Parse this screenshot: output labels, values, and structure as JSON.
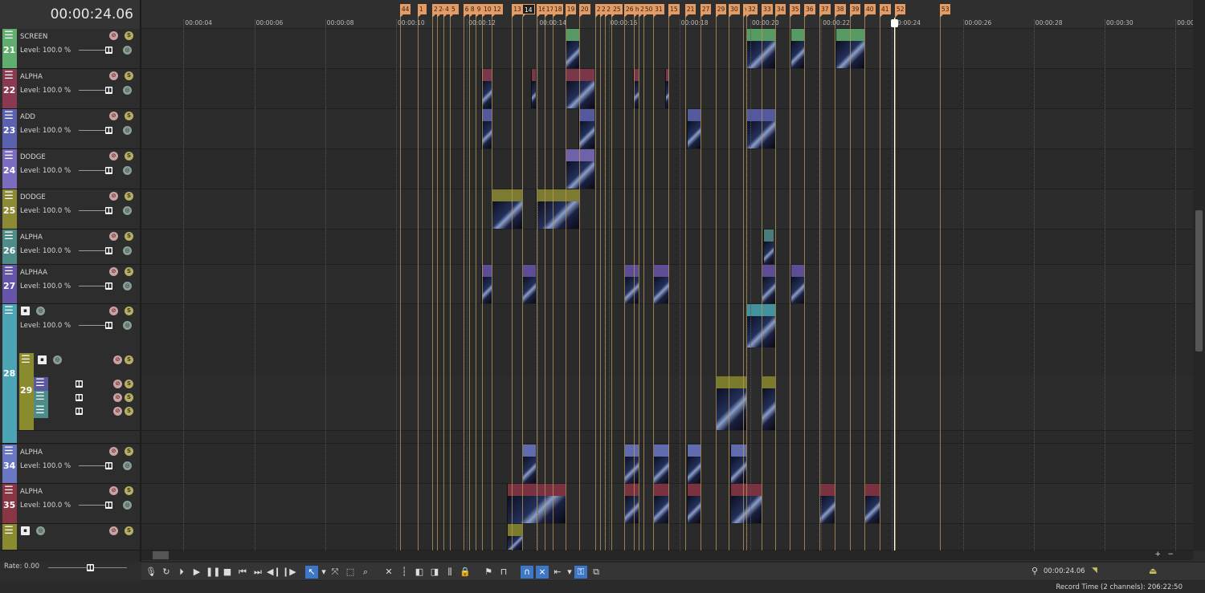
{
  "timecode": "00:00:24.06",
  "ruler_labels": [
    {
      "t": 4,
      "label": "00:00:04"
    },
    {
      "t": 6,
      "label": "00:00:06"
    },
    {
      "t": 8,
      "label": "00:00:08"
    },
    {
      "t": 10,
      "label": "00:00:10"
    },
    {
      "t": 12,
      "label": "00:00:12"
    },
    {
      "t": 14,
      "label": "00:00:14"
    },
    {
      "t": 16,
      "label": "00:00:16"
    },
    {
      "t": 18,
      "label": "00:00:18"
    },
    {
      "t": 20,
      "label": "00:00:20"
    },
    {
      "t": 22,
      "label": "00:00:22"
    },
    {
      "t": 24,
      "label": "00:00:24"
    },
    {
      "t": 26,
      "label": "00:00:26"
    },
    {
      "t": 28,
      "label": "00:00:28"
    },
    {
      "t": 30,
      "label": "00:00:30"
    },
    {
      "t": 32,
      "label": "00:00:32"
    }
  ],
  "playhead_time": 24.06,
  "markers": [
    [
      "44",
      10.11
    ],
    [
      "1",
      10.61
    ],
    [
      "2",
      11.02
    ],
    [
      "24",
      11.16
    ],
    [
      "4",
      11.34
    ],
    [
      "5",
      11.52
    ],
    [
      "6",
      11.9
    ],
    [
      "8",
      12.06
    ],
    [
      "9",
      12.24
    ],
    [
      "10",
      12.43
    ],
    [
      "12",
      12.7
    ],
    [
      "13",
      13.27
    ],
    [
      "14",
      13.56
    ],
    [
      "16",
      13.97
    ],
    [
      "17",
      14.19
    ],
    [
      "18",
      14.42
    ],
    [
      "19",
      14.78
    ],
    [
      "20",
      15.17
    ],
    [
      "2",
      15.62
    ],
    [
      "2",
      15.76
    ],
    [
      "2",
      15.9
    ],
    [
      "25",
      16.08
    ],
    [
      "26",
      16.44
    ],
    [
      "ha",
      16.71
    ],
    [
      "2",
      16.85
    ],
    [
      "50",
      16.98
    ],
    [
      "31",
      17.26
    ],
    [
      "15",
      17.69
    ],
    [
      "21",
      18.16
    ],
    [
      "27",
      18.59
    ],
    [
      "29",
      19.02
    ],
    [
      "30",
      19.39
    ],
    [
      "ve",
      19.8
    ],
    [
      "32",
      19.89
    ],
    [
      "33",
      20.32
    ],
    [
      "34",
      20.7
    ],
    [
      "35",
      21.11
    ],
    [
      "36",
      21.52
    ],
    [
      "37",
      21.95
    ],
    [
      "38",
      22.38
    ],
    [
      "39",
      22.81
    ],
    [
      "40",
      23.22
    ],
    [
      "41",
      23.65
    ],
    [
      "52",
      24.08
    ],
    [
      "53",
      25.35
    ]
  ],
  "selected_marker": "14",
  "tracks": [
    {
      "num": "21",
      "name": "SCREEN",
      "level": "Level: 100.0 %",
      "color": "#5fae6e",
      "clips": [
        [
          14.78,
          15.17
        ],
        [
          19.89,
          20.7
        ],
        [
          21.13,
          21.52
        ],
        [
          22.4,
          23.22
        ]
      ]
    },
    {
      "num": "22",
      "name": "ALPHA",
      "level": "Level: 100.0 %",
      "color": "#8a3a50",
      "clips": [
        [
          12.4,
          12.7
        ],
        [
          13.82,
          13.95
        ],
        [
          14.78,
          15.6
        ],
        [
          16.7,
          16.85
        ],
        [
          17.6,
          17.71
        ]
      ]
    },
    {
      "num": "23",
      "name": "ADD",
      "level": "Level: 100.0 %",
      "color": "#5a62b0",
      "clips": [
        [
          12.4,
          12.7
        ],
        [
          15.15,
          15.6
        ],
        [
          18.2,
          18.6
        ],
        [
          19.89,
          20.7
        ]
      ]
    },
    {
      "num": "24",
      "name": "DODGE",
      "level": "Level: 100.0 %",
      "color": "#7c6cc0",
      "clips": [
        [
          14.78,
          15.6
        ]
      ]
    },
    {
      "num": "25",
      "name": "DODGE",
      "level": "Level: 100.0 %",
      "color": "#8c8a34",
      "clips": [
        [
          12.7,
          13.56
        ],
        [
          13.95,
          15.17
        ]
      ]
    },
    {
      "num": "26",
      "name": "ALPHA",
      "level": "Level: 100.0 %",
      "color": "#4e8c8a",
      "clips": [
        [
          20.36,
          20.66
        ]
      ]
    },
    {
      "num": "27",
      "name": "ALPHAA",
      "level": "Level: 100.0 %",
      "color": "#6654a8",
      "clips": [
        [
          12.4,
          12.7
        ],
        [
          13.56,
          13.95
        ],
        [
          16.44,
          16.85
        ],
        [
          17.26,
          17.71
        ],
        [
          20.32,
          20.7
        ],
        [
          21.13,
          21.52
        ]
      ]
    },
    {
      "num": "28",
      "name": "",
      "level": "Level: 100.0 %",
      "color": "#4aa4b4",
      "clips": [
        [
          19.89,
          20.7
        ]
      ]
    },
    {
      "num": "29",
      "name": "",
      "level": "",
      "color": "#8a8a2e",
      "clips": [
        [
          19.02,
          19.89
        ],
        [
          20.32,
          20.7
        ]
      ]
    },
    {
      "num": "34",
      "name": "ALPHA",
      "level": "Level: 100.0 %",
      "color": "#6a78c4",
      "clips": [
        [
          13.56,
          13.95
        ],
        [
          16.44,
          16.85
        ],
        [
          17.26,
          17.71
        ],
        [
          18.2,
          18.6
        ],
        [
          19.43,
          19.89
        ]
      ]
    },
    {
      "num": "35",
      "name": "ALPHA",
      "level": "Level: 100.0 %",
      "color": "#8a3444",
      "clips": [
        [
          13.13,
          14.78
        ],
        [
          16.44,
          16.85
        ],
        [
          17.26,
          17.71
        ],
        [
          18.2,
          18.6
        ],
        [
          19.43,
          20.32
        ],
        [
          21.95,
          22.4
        ],
        [
          23.22,
          23.65
        ]
      ]
    },
    {
      "num": "",
      "name": "",
      "level": "",
      "color": "#8a8a2e",
      "clips": [
        [
          13.13,
          13.56
        ]
      ]
    }
  ],
  "rate": "Rate: 0.00",
  "transport": [
    "record",
    "loop",
    "play-from-start",
    "play",
    "pause",
    "stop",
    "go-to-start",
    "go-to-end",
    "previous-frame",
    "next-frame",
    "normal-edit-tool",
    "dropdown",
    "envelope-tool",
    "selection-tool",
    "zoom-tool",
    "delete",
    "trim",
    "trim-start",
    "trim-end",
    "split",
    "lock",
    "insert-marker",
    "insert-region",
    "snapping",
    "auto-crossfade",
    "auto-ripple",
    "dropdown",
    "lock-envelopes",
    "ignore-grouping"
  ],
  "active_tools": [
    "normal-edit-tool",
    "snapping",
    "auto-crossfade",
    "lock-envelopes"
  ],
  "cursor_time": "00:00:24.06",
  "record_time": "Record Time (2 channels): 206:22:50"
}
